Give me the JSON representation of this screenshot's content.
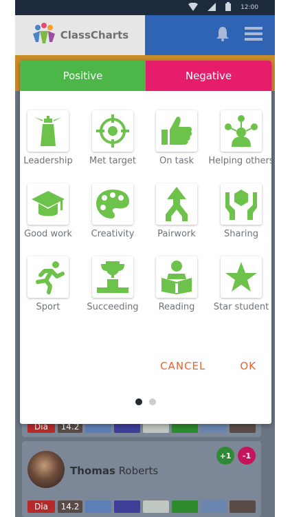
{
  "status": {
    "time": "12:00"
  },
  "app": {
    "logo_text": "ClassCharts"
  },
  "dialog": {
    "tabs": [
      {
        "label": "Positive",
        "color": "#4cb648"
      },
      {
        "label": "Negative",
        "color": "#e51d6b"
      }
    ],
    "behaviours": [
      {
        "label": "Leadership",
        "icon": "lighthouse-icon"
      },
      {
        "label": "Met target",
        "icon": "crosshair-icon"
      },
      {
        "label": "On task",
        "icon": "thumbs-up-icon"
      },
      {
        "label": "Helping others",
        "icon": "network-person-icon"
      },
      {
        "label": "Good work",
        "icon": "graduation-cap-icon"
      },
      {
        "label": "Creativity",
        "icon": "palette-icon"
      },
      {
        "label": "Pairwork",
        "icon": "merge-arrows-icon"
      },
      {
        "label": "Sharing",
        "icon": "hands-hexagon-icon"
      },
      {
        "label": "Sport",
        "icon": "runner-icon"
      },
      {
        "label": "Succeeding",
        "icon": "trophy-podium-icon"
      },
      {
        "label": "Reading",
        "icon": "reader-icon"
      },
      {
        "label": "Star student",
        "icon": "star-icon"
      }
    ],
    "cancel_label": "CANCEL",
    "ok_label": "OK",
    "icon_color": "#6cc24a",
    "action_color": "#e8642c",
    "page_count": 2,
    "active_page": 1
  },
  "background": {
    "top_row": {
      "chip1": "Dia",
      "chip2": "14.2"
    },
    "student": {
      "first_name": "Thomas",
      "last_name": "Roberts",
      "plus_badge": "+1",
      "minus_badge": "-1",
      "chip1": "Dia",
      "chip2": "14.2"
    }
  }
}
